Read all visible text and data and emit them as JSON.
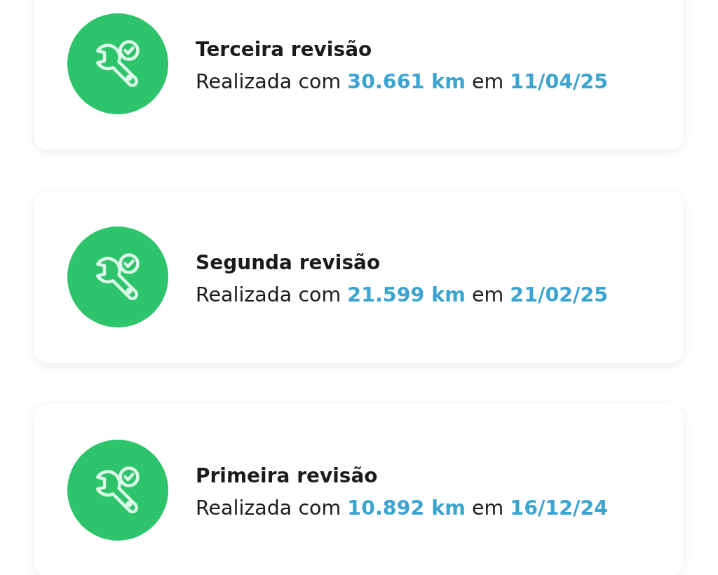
{
  "revisions": [
    {
      "title": "Terceira revisão",
      "summary": {
        "prefix": "Realizada com",
        "mileage": "30.661 km",
        "connector": "em",
        "date": "11/04/25"
      }
    },
    {
      "title": "Segunda revisão",
      "summary": {
        "prefix": "Realizada com",
        "mileage": "21.599 km",
        "connector": "em",
        "date": "21/02/25"
      }
    },
    {
      "title": "Primeira revisão",
      "summary": {
        "prefix": "Realizada com",
        "mileage": "10.892 km",
        "connector": "em",
        "date": "16/12/24"
      }
    }
  ]
}
